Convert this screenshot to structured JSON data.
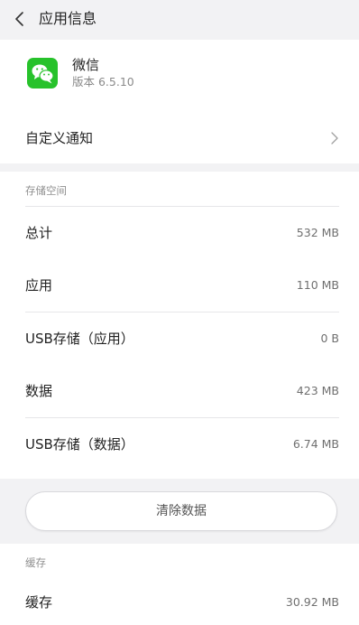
{
  "header": {
    "back_icon": "chevron-left-icon",
    "title": "应用信息"
  },
  "app": {
    "icon": "wechat-icon",
    "icon_color": "#27c22b",
    "name": "微信",
    "version": "版本 6.5.10"
  },
  "notification": {
    "label": "自定义通知",
    "icon": "chevron-right-icon"
  },
  "storage": {
    "header": "存储空间",
    "rows": [
      {
        "label": "总计",
        "value": "532 MB"
      },
      {
        "label": "应用",
        "value": "110 MB"
      },
      {
        "label": "USB存储（应用）",
        "value": "0 B"
      },
      {
        "label": "数据",
        "value": "423 MB"
      },
      {
        "label": "USB存储（数据）",
        "value": "6.74 MB"
      }
    ],
    "clear_button": "清除数据"
  },
  "cache": {
    "header": "缓存",
    "rows": [
      {
        "label": "缓存",
        "value": "30.92 MB"
      }
    ]
  }
}
